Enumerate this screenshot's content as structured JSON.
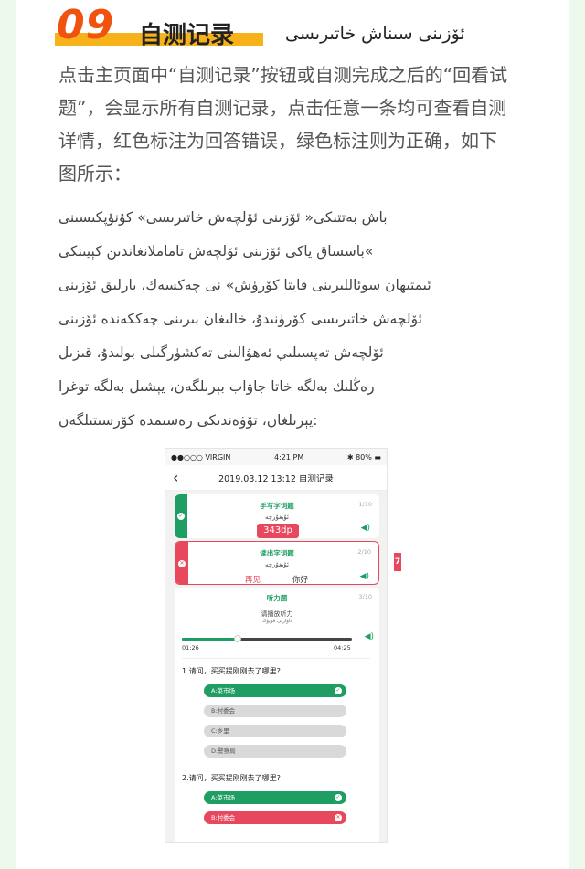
{
  "header": {
    "number": "09",
    "title_zh": "自测记录",
    "title_ug": "ئۆزىنى سىناش خاتىرىسى"
  },
  "paragraph_zh": [
    "点击主页面中“自测记录”按钮或自测完成之后的“回看试",
    "题”，会显示所有自测记录，点击任意一条均可查看自测",
    "详情，红色标注为回答错误，绿色标注则为正确，如下",
    "图所示："
  ],
  "paragraph_ug": [
    "باش بەتتىكى« ئۆزىنى ئۆلچەش خاتىرىسى» كۇنۇپكىسىنى",
    "باسساق ياكى ئۆزىنى ئۆلچەش تاماملانغاندىن كېيىنكى«",
    "ئىمتىھان سوئاللىرىنى قايتا كۆرۈش» نى چەكسەك، بارلىق ئۆزىنى",
    "ئۆلچەش خاتىرىسى كۆرۈنىدۇ، خالىغان بىرىنى چەككەندە ئۆزىنى",
    "ئۆلچەش تەپسىلىي ئەھۋالىنى تەكشۈرگىلى بولىدۇ، قىزىل",
    "رەڭلىك بەلگە خاتا جاۋاب بېرىلگەن، يېشىل بەلگە توغرا",
    "يېزىلغان، تۆۋەندىكى رەسىمدە كۆرسىتىلگەن:"
  ],
  "phone": {
    "status": {
      "carrier": "●●○○○ VIRGIN",
      "time": "4:21 PM",
      "battery": "80%"
    },
    "nav_title": "2019.03.12 13:12 自测记录",
    "card1": {
      "title": "手写字词题",
      "count": "1/10",
      "ug": "ئۇيغۇرچە",
      "answer": "343dp",
      "status": "correct"
    },
    "card2": {
      "title": "读出字词题",
      "count": "2/10",
      "ug": "ئۇيغۇرچە",
      "answer_wrong": "再见",
      "answer_right": "你好",
      "status": "wrong"
    },
    "card3": {
      "title": "听力题",
      "count": "3/10",
      "play_label": "请播放听力",
      "play_ug": "ئاۋازنى قويۇڭ",
      "time_start": "01:26",
      "time_end": "04:25",
      "progress": 0.33,
      "q1": "1.请问，买买提刚刚去了哪里?",
      "q1_options": [
        {
          "label": "A:菜市场",
          "state": "correct"
        },
        {
          "label": "B:村委会",
          "state": "none"
        },
        {
          "label": "C:乡里",
          "state": "none"
        },
        {
          "label": "D:警察局",
          "state": "none"
        }
      ],
      "q2": "2.请问，买买提刚刚去了哪里?",
      "q2_options": [
        {
          "label": "A:菜市场",
          "state": "correct"
        },
        {
          "label": "B:村委会",
          "state": "wrong"
        }
      ]
    },
    "side_tag": "7"
  },
  "colors": {
    "green": "#1f9e63",
    "red": "#e8485d",
    "orange": "#f0520f",
    "yellow": "#f6b11b"
  }
}
